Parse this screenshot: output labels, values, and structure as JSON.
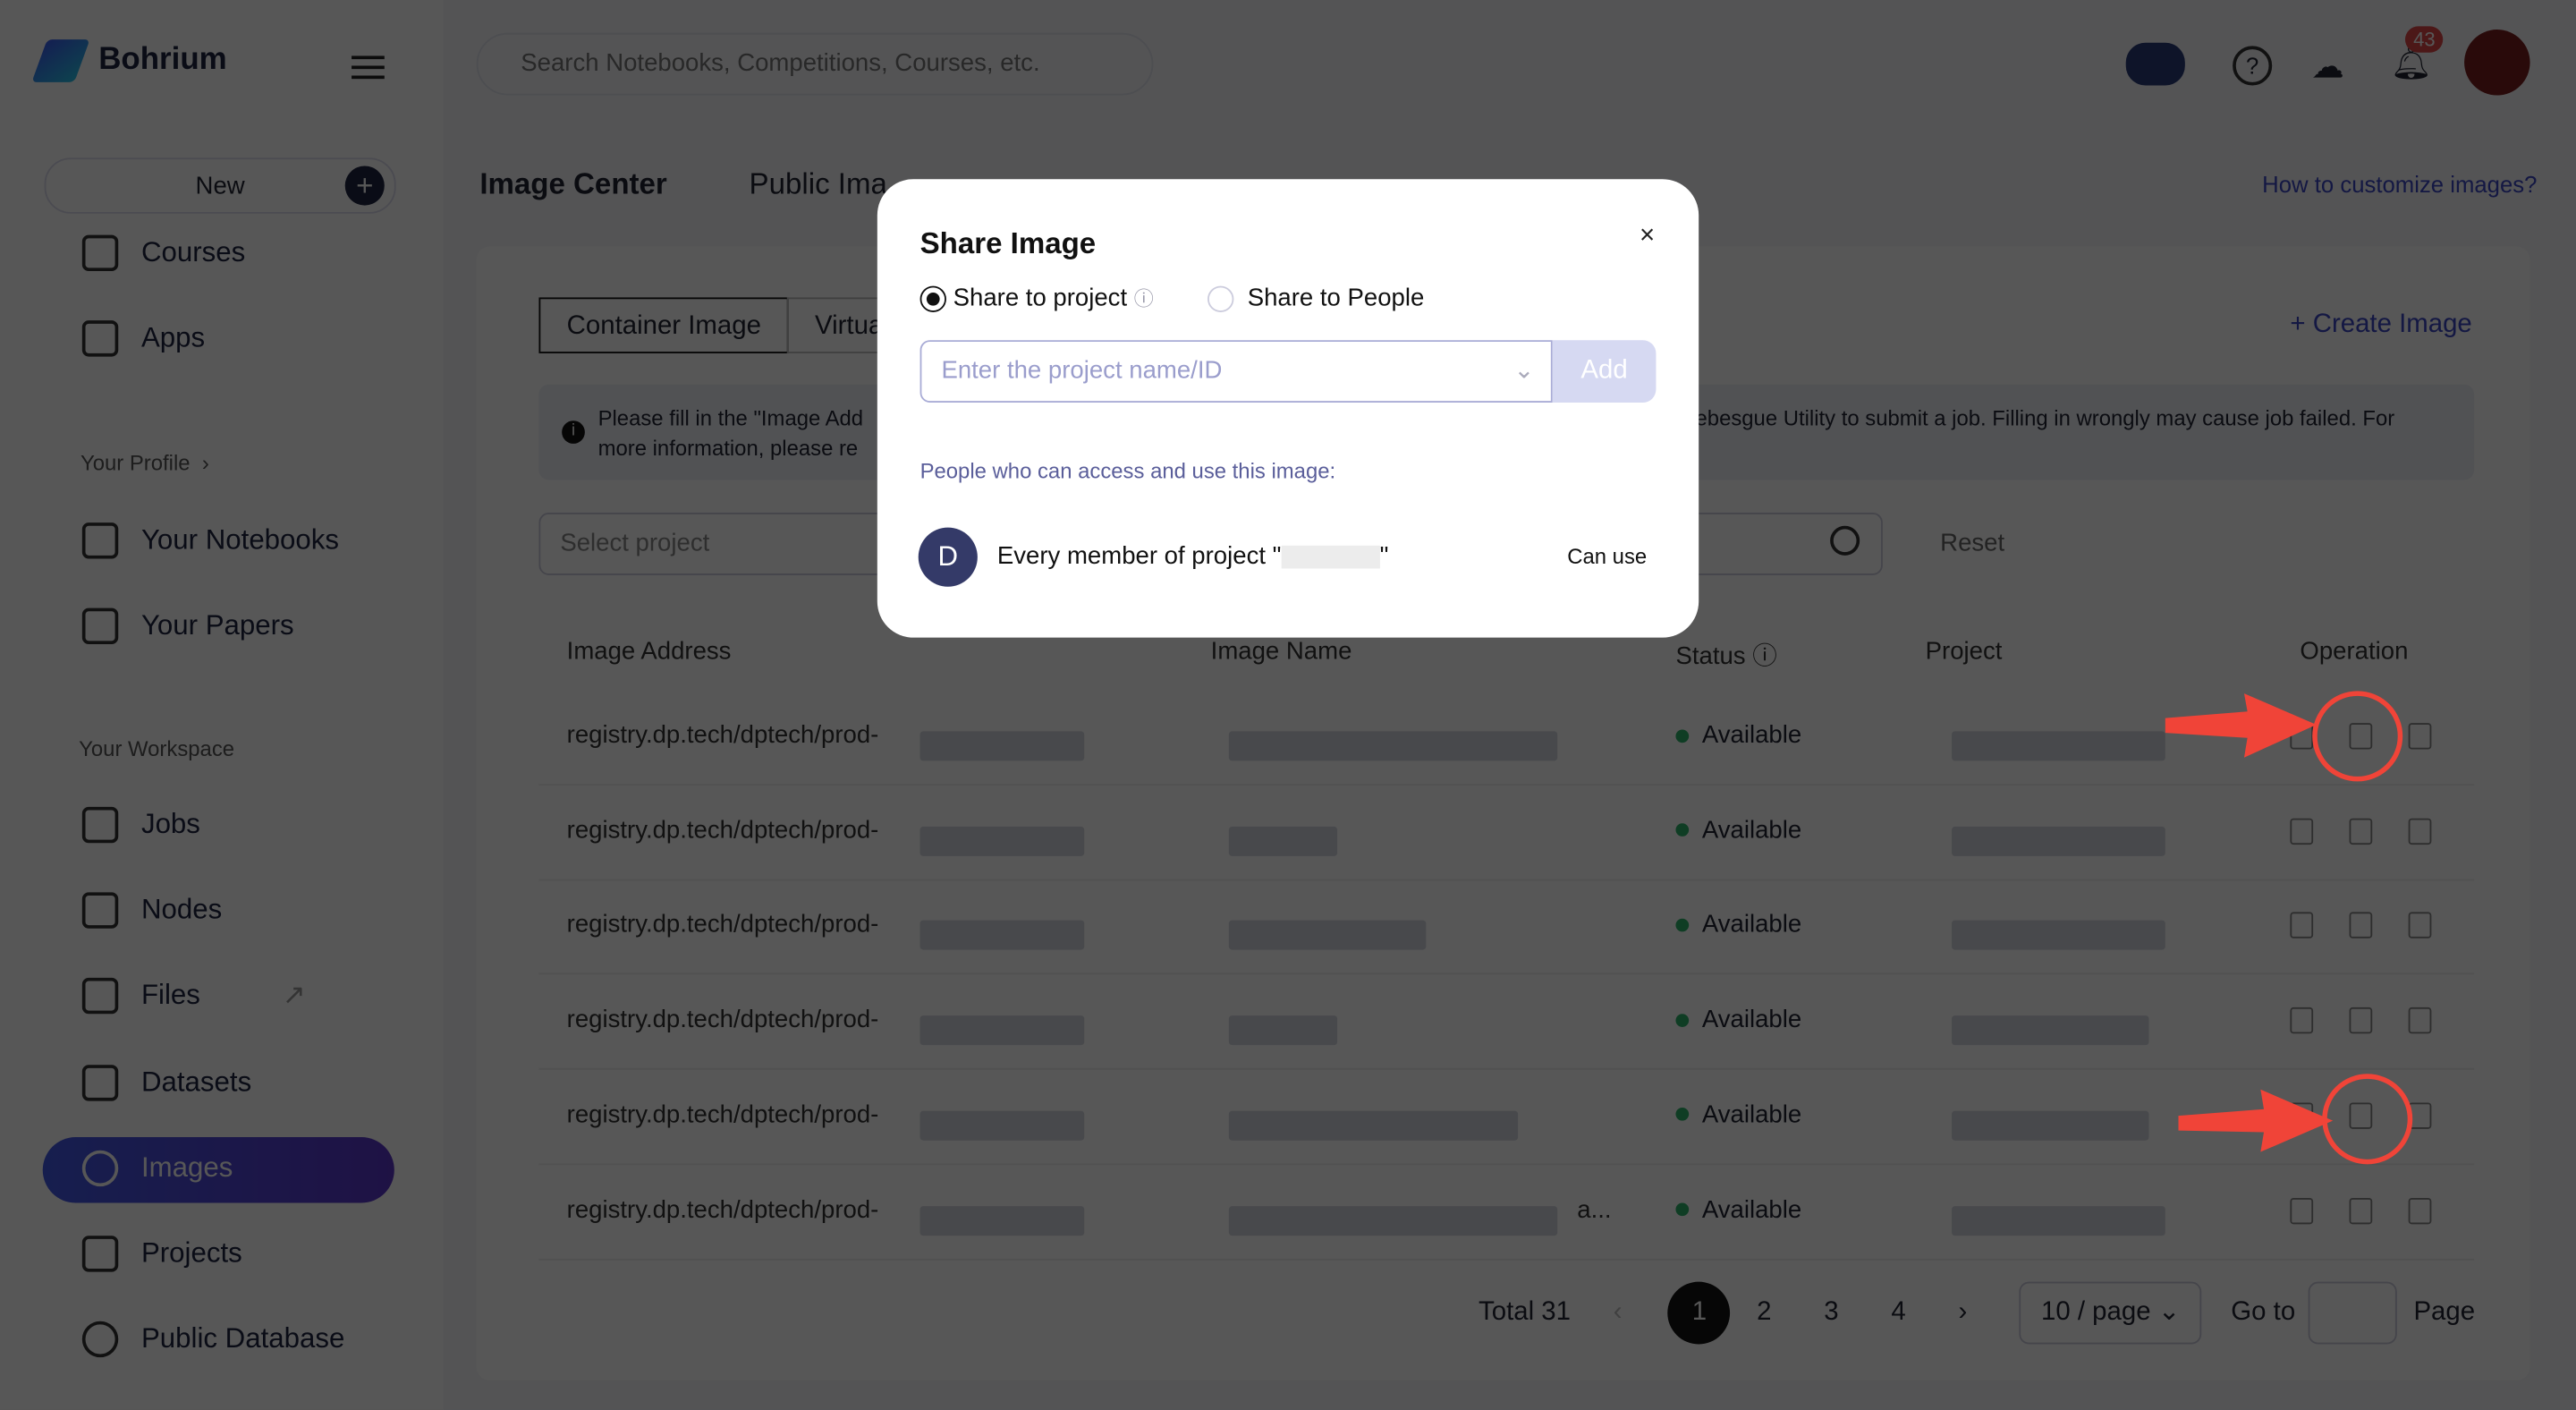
{
  "app": {
    "name": "Bohrium"
  },
  "header": {
    "search_placeholder": "Search Notebooks, Competitions, Courses, etc.",
    "notification_count": "43"
  },
  "sidebar": {
    "new_label": "New",
    "items_top": [
      {
        "label": "Courses"
      },
      {
        "label": "Apps"
      }
    ],
    "profile_section": "Your Profile",
    "profile_items": [
      {
        "label": "Your Notebooks"
      },
      {
        "label": "Your Papers"
      }
    ],
    "workspace_section": "Your Workspace",
    "workspace_items": [
      {
        "label": "Jobs"
      },
      {
        "label": "Nodes"
      },
      {
        "label": "Files"
      },
      {
        "label": "Datasets"
      },
      {
        "label": "Images",
        "active": true
      },
      {
        "label": "Projects"
      },
      {
        "label": "Public Database"
      }
    ]
  },
  "main": {
    "tabs": [
      {
        "label": "Image Center",
        "active": true
      },
      {
        "label": "Public Ima"
      }
    ],
    "help_link": "How to customize images?",
    "segments": [
      {
        "label": "Container Image",
        "active": true
      },
      {
        "label": "Virtua"
      }
    ],
    "create_label": "+ Create Image",
    "notice_left": "Please fill in the \"Image Add",
    "notice_left2": "more information, please re",
    "notice_right": "ebesgue Utility to submit a job. Filling in wrongly may cause job failed. For",
    "select_project_placeholder": "Select project",
    "reset_label": "Reset",
    "columns": [
      "Image Address",
      "Image Name",
      "Status",
      "Project",
      "Operation"
    ],
    "rows": [
      {
        "address": "registry.dp.tech/dptech/prod-",
        "name_suffix": "",
        "status": "Available"
      },
      {
        "address": "registry.dp.tech/dptech/prod-",
        "name_suffix": "",
        "status": "Available"
      },
      {
        "address": "registry.dp.tech/dptech/prod-",
        "name_suffix": "",
        "status": "Available"
      },
      {
        "address": "registry.dp.tech/dptech/prod-",
        "name_suffix": "",
        "status": "Available"
      },
      {
        "address": "registry.dp.tech/dptech/prod-",
        "name_suffix": "",
        "status": "Available"
      },
      {
        "address": "registry.dp.tech/dptech/prod-",
        "name_suffix": "a...",
        "status": "Available"
      }
    ],
    "pagination": {
      "total": "Total 31",
      "pages": [
        "1",
        "2",
        "3",
        "4"
      ],
      "current": "1",
      "page_size": "10 / page",
      "goto_label": "Go to",
      "page_label": "Page"
    }
  },
  "modal": {
    "title": "Share Image",
    "option_project": "Share to project",
    "option_people": "Share to People",
    "selected": "project",
    "input_placeholder": "Enter the project name/ID",
    "add_label": "Add",
    "access_label": "People who can access and use this image:",
    "member_initial": "D",
    "member_text": "Every member of project \"",
    "member_text_end": "\"",
    "permission": "Can use"
  },
  "colors": {
    "accent": "#3b46c4",
    "annotation": "#f04438",
    "avatar": "#343a68"
  }
}
